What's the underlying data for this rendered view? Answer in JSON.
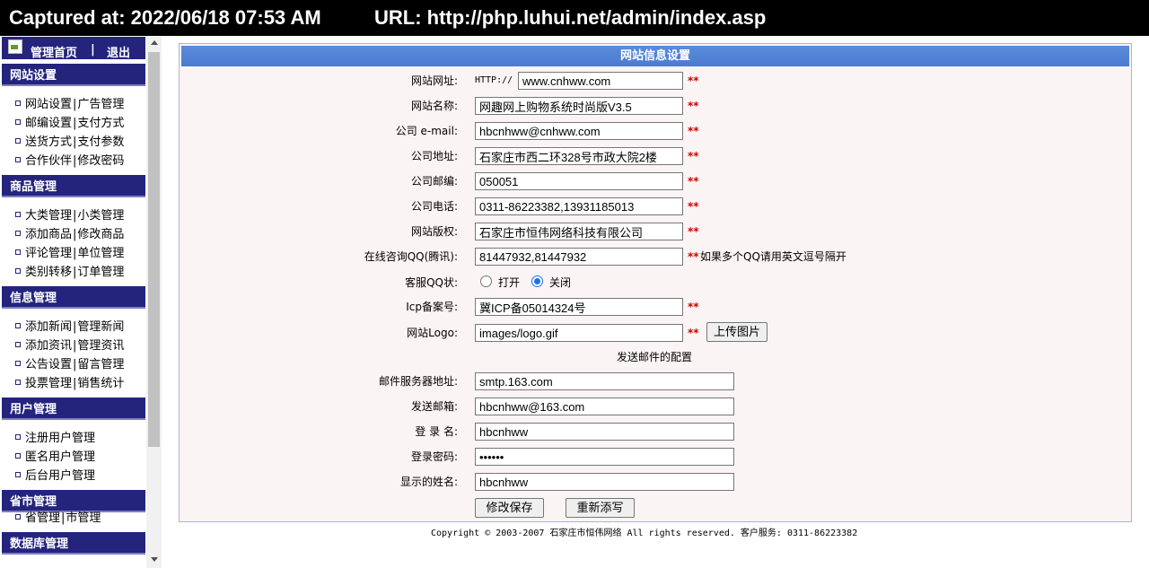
{
  "capture": {
    "time_text": "Captured at: 2022/06/18 07:53 AM",
    "url_text": "URL: http://php.luhui.net/admin/index.asp"
  },
  "top": {
    "home": "管理首页",
    "separator": "|",
    "logout": "退出"
  },
  "sections": [
    {
      "title": "网站设置",
      "rows": [
        [
          "网站设置",
          "广告管理"
        ],
        [
          "邮编设置",
          "支付方式"
        ],
        [
          "送货方式",
          "支付参数"
        ],
        [
          "合作伙伴",
          "修改密码"
        ]
      ]
    },
    {
      "title": "商品管理",
      "rows": [
        [
          "大类管理",
          "小类管理"
        ],
        [
          "添加商品",
          "修改商品"
        ],
        [
          "评论管理",
          "单位管理"
        ],
        [
          "类别转移",
          "订单管理"
        ]
      ]
    },
    {
      "title": "信息管理",
      "rows": [
        [
          "添加新闻",
          "管理新闻"
        ],
        [
          "添加资讯",
          "管理资讯"
        ],
        [
          "公告设置",
          "留言管理"
        ],
        [
          "投票管理",
          "销售统计"
        ]
      ]
    },
    {
      "title": "用户管理",
      "rows": [
        [
          "注册用户管理"
        ],
        [
          "匿名用户管理"
        ],
        [
          "后台用户管理"
        ]
      ]
    },
    {
      "title": "省市管理",
      "rows": [
        [
          "省管理",
          "市管理"
        ]
      ]
    },
    {
      "title": "数据库管理",
      "rows": []
    }
  ],
  "form": {
    "title": "网站信息设置",
    "http_prefix": "HTTP://",
    "required_mark": "**",
    "fields": [
      {
        "label": "网站网址:",
        "value": "www.cnhww.com"
      },
      {
        "label": "网站名称:",
        "value": "网趣网上购物系统时尚版V3.5"
      },
      {
        "label": "公司 e-mail:",
        "value": "hbcnhww@cnhww.com"
      },
      {
        "label": "公司地址:",
        "value": "石家庄市西二环328号市政大院2楼"
      },
      {
        "label": "公司邮编:",
        "value": "050051"
      },
      {
        "label": "公司电话:",
        "value": "0311-86223382,13931185013"
      },
      {
        "label": "网站版权:",
        "value": "石家庄市恒伟网络科技有限公司"
      },
      {
        "label": "在线咨询QQ(腾讯):",
        "value": "81447932,81447932"
      }
    ],
    "qq_hint": "如果多个QQ请用英文逗号隔开",
    "qq_status": {
      "label": "客服QQ状:",
      "options": [
        "打开",
        "关闭"
      ],
      "selected": "关闭"
    },
    "icp": {
      "label": "Icp备案号:",
      "value": "冀ICP备05014324号"
    },
    "logo": {
      "label": "网站Logo:",
      "value": "images/logo.gif",
      "upload_button": "上传图片"
    },
    "mail_heading": "发送邮件的配置",
    "mail_fields": [
      {
        "label": "邮件服务器地址:",
        "value": "smtp.163.com"
      },
      {
        "label": "发送邮箱:",
        "value": "hbcnhww@163.com"
      },
      {
        "label": "登 录 名:",
        "value": "hbcnhww"
      },
      {
        "label": "登录密码:",
        "value": "••••••"
      },
      {
        "label": "显示的姓名:",
        "value": "hbcnhww"
      }
    ],
    "save_button": "修改保存",
    "reset_button": "重新添写"
  },
  "footer": "Copyright © 2003-2007 石家庄市恒伟网络 All rights reserved. 客户服务: 0311-86223382"
}
